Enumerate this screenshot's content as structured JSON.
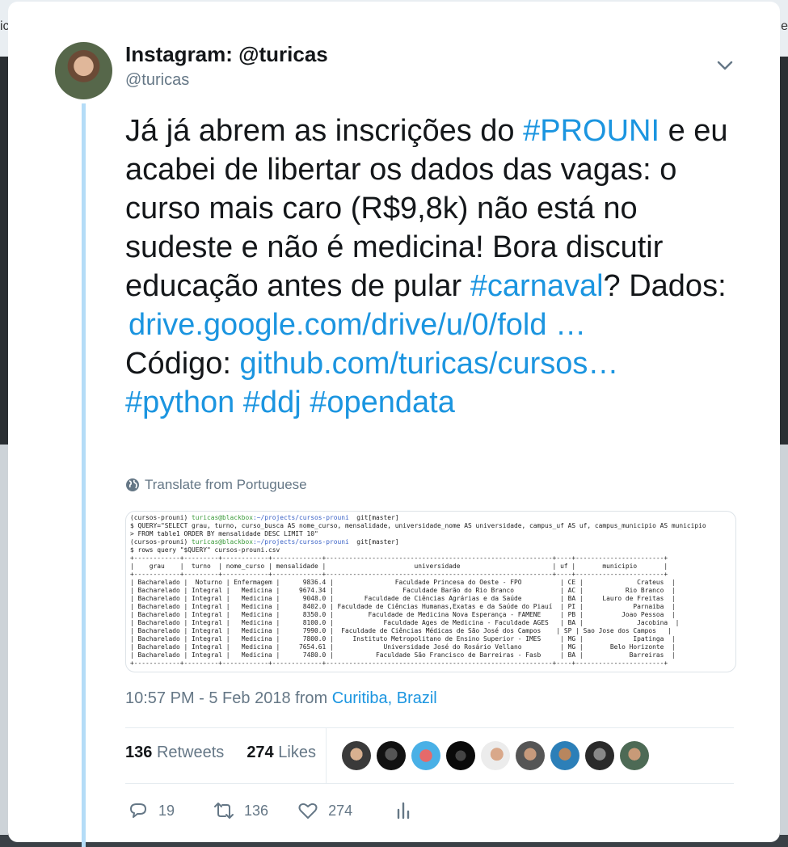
{
  "tweet": {
    "display_name": "Instagram: @turicas",
    "handle": "@turicas",
    "text": {
      "p1": "Já já abrem as inscrições do ",
      "tag_prouni": "#PROUNI",
      "p2": " e eu acabei de libertar os dados das vagas: o curso mais caro (R$9,8k) não está no sudeste e não é medicina! Bora discutir educação antes de pular ",
      "tag_carnaval": "#carnaval",
      "p3": "? Dados: ",
      "link_drive": "drive.google.com/drive/u/0/fold …",
      "p4": "Código: ",
      "link_github": "github.com/turicas/cursos…",
      "tag_python": "#python",
      "tag_ddj": "#ddj",
      "tag_opendata": "#opendata"
    },
    "translate_label": "Translate from Portuguese",
    "timestamp": "10:57 PM - 5 Feb 2018",
    "from_label": " from ",
    "location": "Curitiba, Brazil",
    "retweets_count": "136",
    "retweets_label": "Retweets",
    "likes_count": "274",
    "likes_label": "Likes",
    "actions": {
      "reply_count": "19",
      "retweet_count": "136",
      "like_count": "274"
    }
  },
  "terminal": {
    "p1": "(cursos-prouni) ",
    "u1": "turicas@blackbox",
    "d1": ":~/projects/cursos-prouni",
    "g1": "  git[master]",
    "l2": "$ QUERY=\"SELECT grau, turno, curso_busca AS nome_curso, mensalidade, universidade_nome AS universidade, campus_uf AS uf, campus_municipio AS municipio",
    "l3": "> FROM table1 ORDER BY mensalidade DESC LIMIT 10\"",
    "p4": "(cursos-prouni) ",
    "u4": "turicas@blackbox",
    "d4": ":~/projects/cursos-prouni",
    "g4": "  git[master]",
    "l5": "$ rows query \"$QUERY\" cursos-prouni.csv",
    "table": "+------------+---------+------------+-------------+-----------------------------------------------------------+----+-----------------------+\n|    grau    |  turno  | nome_curso | mensalidade |                       universidade                        | uf |       municipio       |\n+------------+---------+------------+-------------+-----------------------------------------------------------+----+-----------------------+\n| Bacharelado |  Noturno | Enfermagem |      9836.4 |                Faculdade Princesa do Oeste - FPO          | CE |              Crateus  |\n| Bacharelado | Integral |   Medicina |     9674.34 |                  Faculdade Barão do Rio Branco            | AC |           Rio Branco  |\n| Bacharelado | Integral |   Medicina |      9048.0 |        Faculdade de Ciências Agrárias e da Saúde          | BA |     Lauro de Freitas  |\n| Bacharelado | Integral |   Medicina |      8402.0 | Faculdade de Ciências Humanas,Exatas e da Saúde do Piauí  | PI |             Parnaiba  |\n| Bacharelado | Integral |   Medicina |      8350.0 |         Faculdade de Medicina Nova Esperança - FAMENE     | PB |          Joao Pessoa  |\n| Bacharelado | Integral |   Medicina |      8100.0 |             Faculdade Ages de Medicina - Faculdade AGES   | BA |              Jacobina  |\n| Bacharelado | Integral |   Medicina |      7990.0 |  Faculdade de Ciências Médicas de São José dos Campos    | SP | Sao Jose dos Campos   |\n| Bacharelado | Integral |   Medicina |      7800.0 |     Instituto Metropolitano de Ensino Superior - IMES     | MG |             Ipatinga  |\n| Bacharelado | Integral |   Medicina |     7654.61 |             Universidade José do Rosário Vellano          | MG |       Belo Horizonte  |\n| Bacharelado | Integral |   Medicina |      7480.0 |           Faculdade São Francisco de Barreiras - Fasb     | BA |            Barreiras  |\n+------------+---------+------------+-------------+-----------------------------------------------------------+----+-----------------------+"
  },
  "background": {
    "left_glyph": "ic",
    "right_glyph": "e"
  },
  "icons": [
    "chevron-down-icon",
    "globe-icon",
    "reply-icon",
    "retweet-icon",
    "like-icon",
    "analytics-icon"
  ],
  "colors": {
    "link": "#1b95e0",
    "muted": "#657786",
    "text": "#14171a",
    "thread": "#b4dcf7"
  }
}
